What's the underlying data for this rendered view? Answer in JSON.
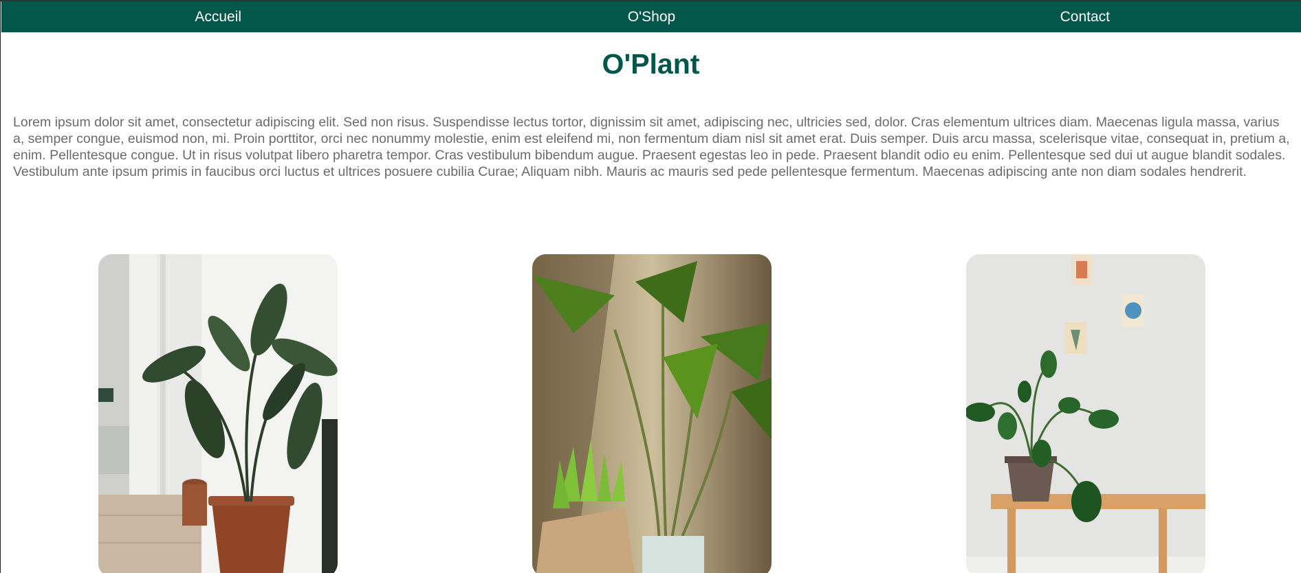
{
  "nav": {
    "items": [
      {
        "label": "Accueil"
      },
      {
        "label": "O'Shop"
      },
      {
        "label": "Contact"
      }
    ]
  },
  "header": {
    "title": "O'Plant"
  },
  "main": {
    "intro": "Lorem ipsum dolor sit amet, consectetur adipiscing elit. Sed non risus. Suspendisse lectus tortor, dignissim sit amet, adipiscing nec, ultricies sed, dolor. Cras elementum ultrices diam. Maecenas ligula massa, varius a, semper congue, euismod non, mi. Proin porttitor, orci nec nonummy molestie, enim est eleifend mi, non fermentum diam nisl sit amet erat. Duis semper. Duis arcu massa, scelerisque vitae, consequat in, pretium a, enim. Pellentesque congue. Ut in risus volutpat libero pharetra tempor. Cras vestibulum bibendum augue. Praesent egestas leo in pede. Praesent blandit odio eu enim. Pellentesque sed dui ut augue blandit sodales. Vestibulum ante ipsum primis in faucibus orci luctus et ultrices posuere cubilia Curae; Aliquam nibh. Mauris ac mauris sed pede pellentesque fermentum. Maecenas adipiscing ante non diam sodales hendrerit."
  },
  "colors": {
    "brand": "#02574a",
    "text": "#6b6b6b",
    "nav_text": "#ffffff"
  }
}
